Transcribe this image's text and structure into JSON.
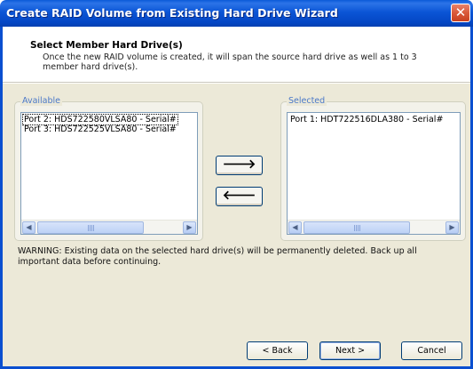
{
  "window": {
    "title": "Create RAID Volume from Existing Hard Drive Wizard",
    "close_glyph": "✕"
  },
  "header": {
    "title": "Select Member Hard Drive(s)",
    "description": "Once the new RAID volume is created, it will span the source hard drive as well as 1 to 3 member hard drive(s)."
  },
  "available": {
    "label": "Available",
    "items": [
      "Port 2: HDS722580VLSA80 - Serial#",
      "Port 3: HDS722525VLSA80 - Serial#"
    ]
  },
  "selected": {
    "label": "Selected",
    "items": [
      "Port 1: HDT722516DLA380 - Serial#"
    ]
  },
  "move_buttons": {
    "add_glyph": "🡒",
    "remove_glyph": "🡐"
  },
  "warning": "WARNING: Existing data on the selected hard drive(s) will be permanently deleted. Back up all important data before continuing.",
  "buttons": {
    "back": "< Back",
    "next": "Next >",
    "cancel": "Cancel"
  },
  "icons": {
    "close": "close-icon",
    "scroll_left": "chevron-left-icon",
    "scroll_right": "chevron-right-icon",
    "arrow_right": "arrow-right-icon",
    "arrow_left": "arrow-left-icon"
  },
  "colors": {
    "titlebar": "#0a55d6",
    "body": "#ece9d8",
    "group_label": "#4a78c8",
    "close_button": "#d9593a"
  }
}
